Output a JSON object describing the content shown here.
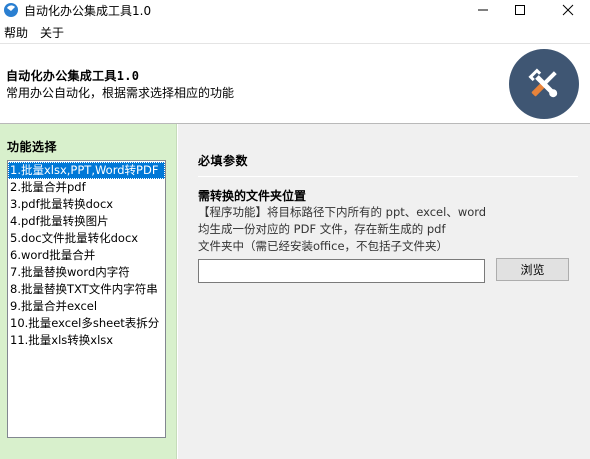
{
  "window": {
    "title": "自动化办公集成工具1.0",
    "icon": "app-icon",
    "controls": [
      "minimize-icon",
      "maximize-icon",
      "close-icon"
    ]
  },
  "menu": {
    "help": "帮助",
    "about": "关于"
  },
  "header": {
    "title": "自动化办公集成工具1.0",
    "subtitle": "常用办公自动化，根据需求选择相应的功能",
    "logo_icon": "wrench-screwdriver-icon",
    "logo_color": "#3f5673"
  },
  "sidebar": {
    "title": "功能选择",
    "selected_index": 0,
    "items": [
      "1.批量xlsx,PPT,Word转PDF",
      "2.批量合并pdf",
      "3.pdf批量转换docx",
      "4.pdf批量转换图片",
      "5.doc文件批量转化docx",
      "6.word批量合并",
      "7.批量替换word内字符",
      "8.批量替换TXT文件内字符串",
      "9.批量合并excel",
      "10.批量excel多sheet表拆分",
      "11.批量xls转换xlsx"
    ]
  },
  "main": {
    "section_title": "必填参数",
    "field_label": "需转换的文件夹位置",
    "description": [
      "【程序功能】将目标路径下内所有的 ppt、excel、word",
      "均生成一份对应的 PDF 文件，存在新生成的 pdf",
      "文件夹中（需已经安装office，不包括子文件夹）"
    ],
    "path_value": "",
    "browse_label": "浏览"
  },
  "colors": {
    "sidebar_bg": "#d8f0cc",
    "selection": "#0078d7",
    "panel_bg": "#f0f0f0"
  }
}
